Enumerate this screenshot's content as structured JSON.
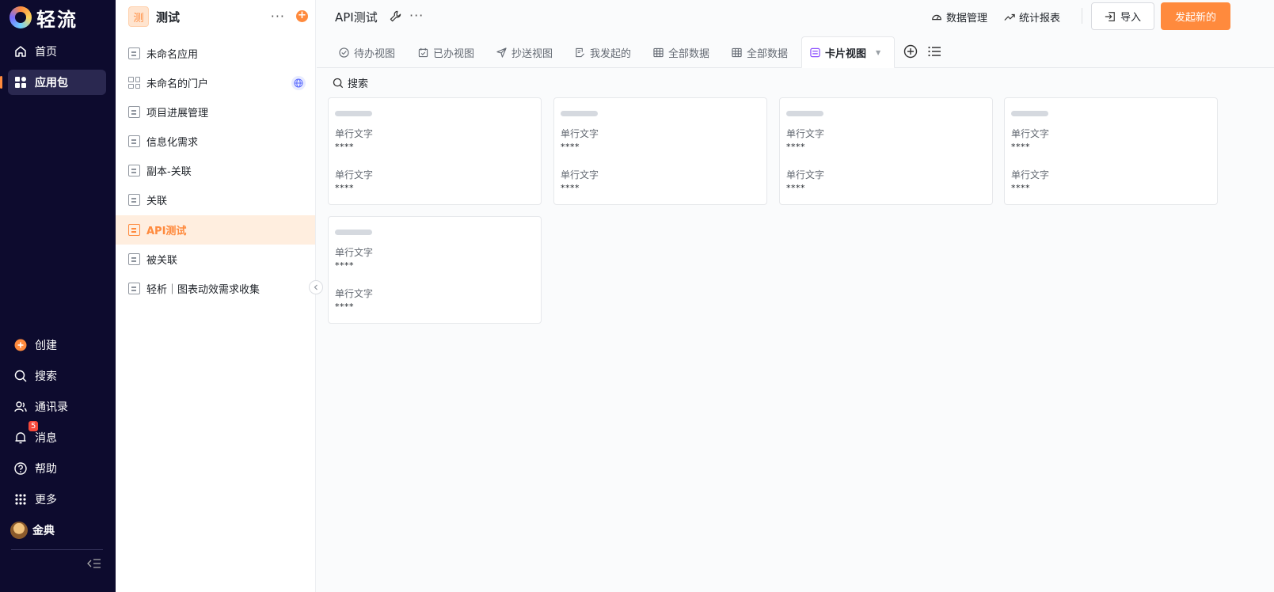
{
  "brand": {
    "name": "轻流"
  },
  "nav": {
    "top_items": [
      {
        "label": "首页",
        "icon": "home-icon"
      },
      {
        "label": "应用包",
        "icon": "grid-icon",
        "active": true
      }
    ],
    "bottom_items": [
      {
        "label": "创建",
        "icon": "plus-circle-icon"
      },
      {
        "label": "搜索",
        "icon": "search-icon"
      },
      {
        "label": "通讯录",
        "icon": "contacts-icon"
      },
      {
        "label": "消息",
        "icon": "bell-icon",
        "badge": "5"
      },
      {
        "label": "帮助",
        "icon": "help-icon"
      },
      {
        "label": "更多",
        "icon": "dots-grid-icon"
      },
      {
        "label": "金典",
        "icon": "avatar"
      }
    ]
  },
  "app_package": {
    "icon_char": "测",
    "title": "测试",
    "items": [
      {
        "label": "未命名应用"
      },
      {
        "label": "未命名的门户",
        "type": "portal"
      },
      {
        "label": "项目进展管理"
      },
      {
        "label": "信息化需求"
      },
      {
        "label": "副本-关联"
      },
      {
        "label": "关联"
      },
      {
        "label": "API测试",
        "active": true
      },
      {
        "label": "被关联"
      },
      {
        "label": "轻析｜图表动效需求收集"
      }
    ]
  },
  "header": {
    "title": "API测试",
    "data_manage": "数据管理",
    "reports": "统计报表",
    "import": "导入",
    "start_new": "发起新的"
  },
  "tabs": [
    {
      "label": "待办视图",
      "icon": "check-circle-icon"
    },
    {
      "label": "已办视图",
      "icon": "calendar-check-icon"
    },
    {
      "label": "抄送视图",
      "icon": "send-icon"
    },
    {
      "label": "我发起的",
      "icon": "doc-edit-icon"
    },
    {
      "label": "全部数据",
      "icon": "table-icon"
    },
    {
      "label": "全部数据",
      "icon": "table-icon"
    },
    {
      "label": "卡片视图",
      "icon": "card-view-icon",
      "active": true
    }
  ],
  "search": {
    "label": "搜索"
  },
  "cards": [
    {
      "f1_label": "单行文字",
      "f1_value": "****",
      "f2_label": "单行文字",
      "f2_value": "****"
    },
    {
      "f1_label": "单行文字",
      "f1_value": "****",
      "f2_label": "单行文字",
      "f2_value": "****"
    },
    {
      "f1_label": "单行文字",
      "f1_value": "****",
      "f2_label": "单行文字",
      "f2_value": "****"
    },
    {
      "f1_label": "单行文字",
      "f1_value": "****",
      "f2_label": "单行文字",
      "f2_value": "****"
    },
    {
      "f1_label": "单行文字",
      "f1_value": "****",
      "f2_label": "单行文字",
      "f2_value": "****"
    }
  ],
  "colors": {
    "accent": "#ff8a3d",
    "nav_bg": "#0d0b2e"
  }
}
